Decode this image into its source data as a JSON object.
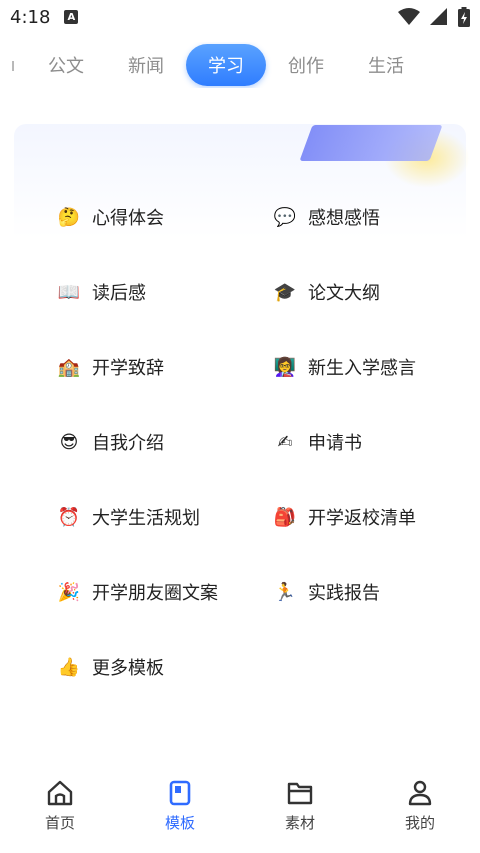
{
  "status": {
    "time": "4:18",
    "notification": "A"
  },
  "tabs": [
    {
      "label": "公文",
      "active": false
    },
    {
      "label": "新闻",
      "active": false
    },
    {
      "label": "学习",
      "active": true
    },
    {
      "label": "创作",
      "active": false
    },
    {
      "label": "生活",
      "active": false
    }
  ],
  "templates": [
    {
      "label": "心得体会",
      "icon": "thinking-face-icon",
      "emoji": "🤔"
    },
    {
      "label": "感想感悟",
      "icon": "speech-bubble-icon",
      "emoji": "💬"
    },
    {
      "label": "读后感",
      "icon": "open-book-icon",
      "emoji": "📖"
    },
    {
      "label": "论文大纲",
      "icon": "graduation-cap-icon",
      "emoji": "🎓"
    },
    {
      "label": "开学致辞",
      "icon": "school-icon",
      "emoji": "🏫"
    },
    {
      "label": "新生入学感言",
      "icon": "teacher-icon",
      "emoji": "👩‍🏫"
    },
    {
      "label": "自我介绍",
      "icon": "sunglasses-face-icon",
      "emoji": "😎"
    },
    {
      "label": "申请书",
      "icon": "writing-hand-icon",
      "emoji": "✍"
    },
    {
      "label": "大学生活规划",
      "icon": "alarm-clock-icon",
      "emoji": "⏰"
    },
    {
      "label": "开学返校清单",
      "icon": "backpack-icon",
      "emoji": "🎒"
    },
    {
      "label": "开学朋友圈文案",
      "icon": "party-popper-icon",
      "emoji": "🎉"
    },
    {
      "label": "实践报告",
      "icon": "running-person-icon",
      "emoji": "🏃"
    },
    {
      "label": "更多模板",
      "icon": "thumbs-up-icon",
      "emoji": "👍"
    }
  ],
  "nav": [
    {
      "label": "首页",
      "icon": "home-icon",
      "active": false
    },
    {
      "label": "模板",
      "icon": "template-icon",
      "active": true
    },
    {
      "label": "素材",
      "icon": "folder-icon",
      "active": false
    },
    {
      "label": "我的",
      "icon": "profile-icon",
      "active": false
    }
  ],
  "colors": {
    "accent": "#2f7dff",
    "nav_active": "#2f6bff",
    "tab_inactive": "#8d8d8d"
  }
}
